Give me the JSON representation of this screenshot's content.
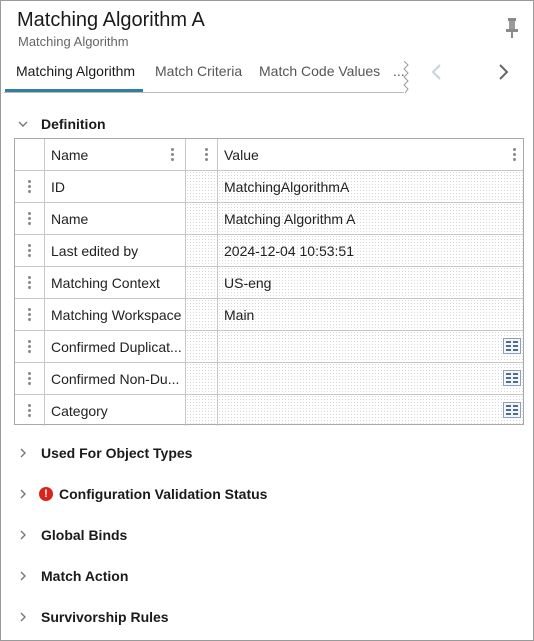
{
  "header": {
    "title": "Matching Algorithm A",
    "subtitle": "Matching Algorithm"
  },
  "tabs": [
    {
      "label": "Matching Algorithm",
      "active": true
    },
    {
      "label": "Match Criteria",
      "active": false
    },
    {
      "label": "Match Code Values",
      "active": false
    },
    {
      "label": "...",
      "active": false
    }
  ],
  "definition": {
    "label": "Definition",
    "columns": {
      "name": "Name",
      "value": "Value"
    },
    "rows": [
      {
        "name": "ID",
        "value": "MatchingAlgorithmA"
      },
      {
        "name": "Name",
        "value": "Matching Algorithm A"
      },
      {
        "name": "Last edited by",
        "value": "2024-12-04 10:53:51"
      },
      {
        "name": "Matching Context",
        "value": "US-eng"
      },
      {
        "name": "Matching Workspace",
        "value": "Main"
      },
      {
        "name": "Confirmed Duplicat...",
        "value": ""
      },
      {
        "name": "Confirmed Non-Du...",
        "value": ""
      },
      {
        "name": "Category",
        "value": ""
      }
    ]
  },
  "sections": [
    {
      "label": "Used For Object Types",
      "icon": null
    },
    {
      "label": "Configuration Validation Status",
      "icon": "error-icon",
      "icon_glyph": "!"
    },
    {
      "label": "Global Binds",
      "icon": null
    },
    {
      "label": "Match Action",
      "icon": null
    },
    {
      "label": "Survivorship Rules",
      "icon": null
    }
  ],
  "colors": {
    "accent": "#2f7fa0",
    "error": "#d9241b"
  }
}
